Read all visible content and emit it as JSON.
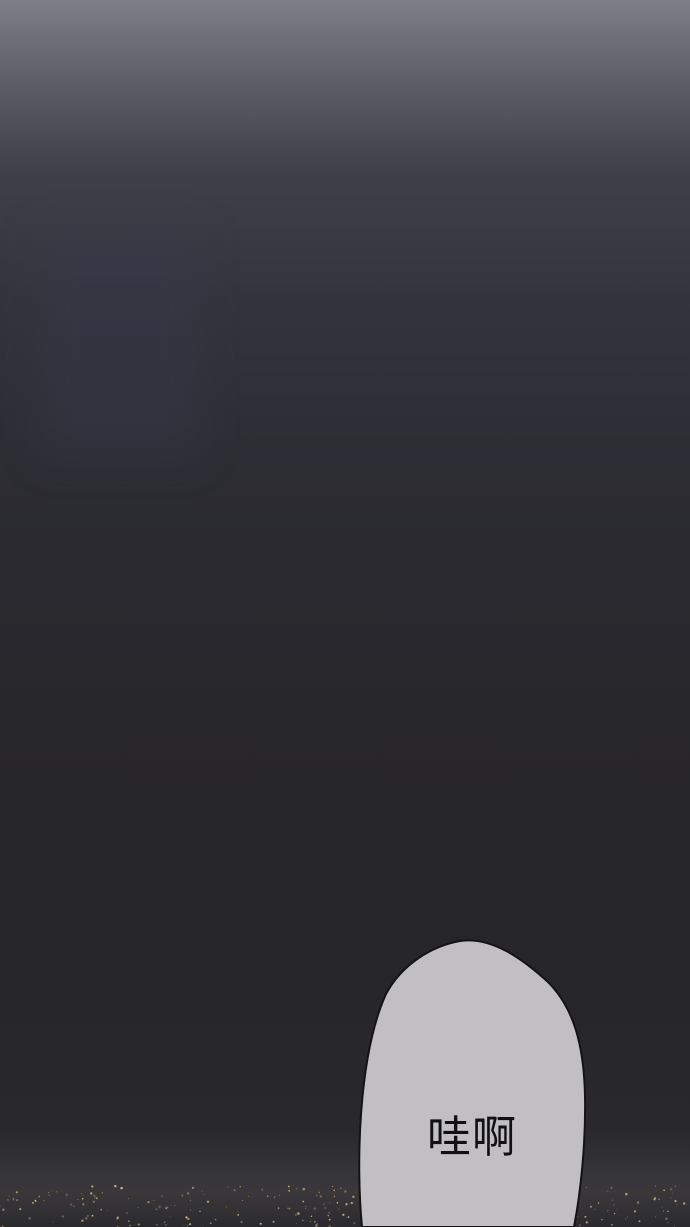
{
  "speech_bubble": {
    "text": "哇啊"
  },
  "colors": {
    "sky_top": "#7d7f86",
    "sky_night": "#262529",
    "bubble_fill": "#c1bfc4",
    "bubble_outline": "#141416",
    "city_lights": "#f2c98a"
  }
}
